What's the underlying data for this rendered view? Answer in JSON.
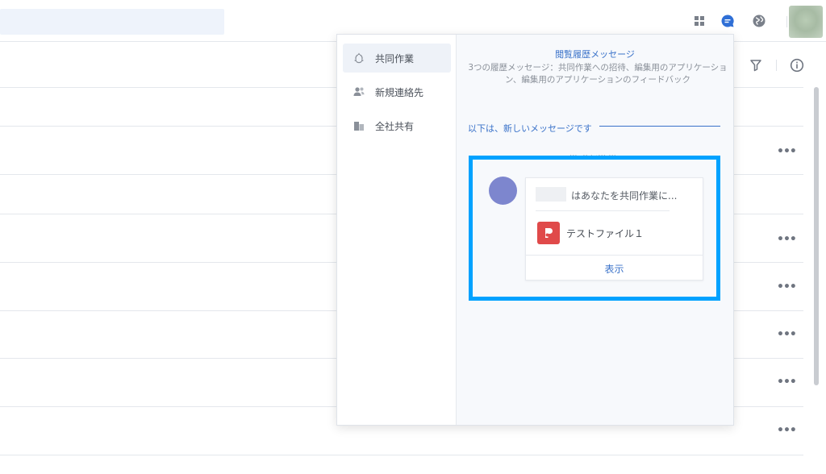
{
  "topbar": {
    "icons": [
      "apps-grid-icon",
      "chat-bubble-icon",
      "globe-icon",
      "user-avatar"
    ]
  },
  "list": {
    "icons": [
      "filter-icon",
      "info-icon"
    ],
    "row_more_label": "•••"
  },
  "popup": {
    "sidebar": {
      "items": [
        {
          "label": "共同作業",
          "icon": "collaboration-icon",
          "active": true
        },
        {
          "label": "新規連絡先",
          "icon": "contacts-icon",
          "active": false
        },
        {
          "label": "全社共有",
          "icon": "company-share-icon",
          "active": false
        }
      ]
    },
    "history_link": "閲覧履歴メッセージ",
    "history_desc": "3つの履歴メッセージ：共同作業への招待、編集用のアプリケーション、編集用のアプリケーションのフィードバック",
    "new_messages_label": "以下は、新しいメッセージです",
    "message": {
      "timestamp": "05-07 20:05",
      "invite_text": "はあなたを共同作業に...",
      "file_name": "テストファイル１",
      "view_label": "表示"
    }
  },
  "colors": {
    "accent": "#3a72c9",
    "highlight_border": "#00a2ff",
    "avatar": "#7d86ce",
    "file_icon": "#e04a4a"
  }
}
